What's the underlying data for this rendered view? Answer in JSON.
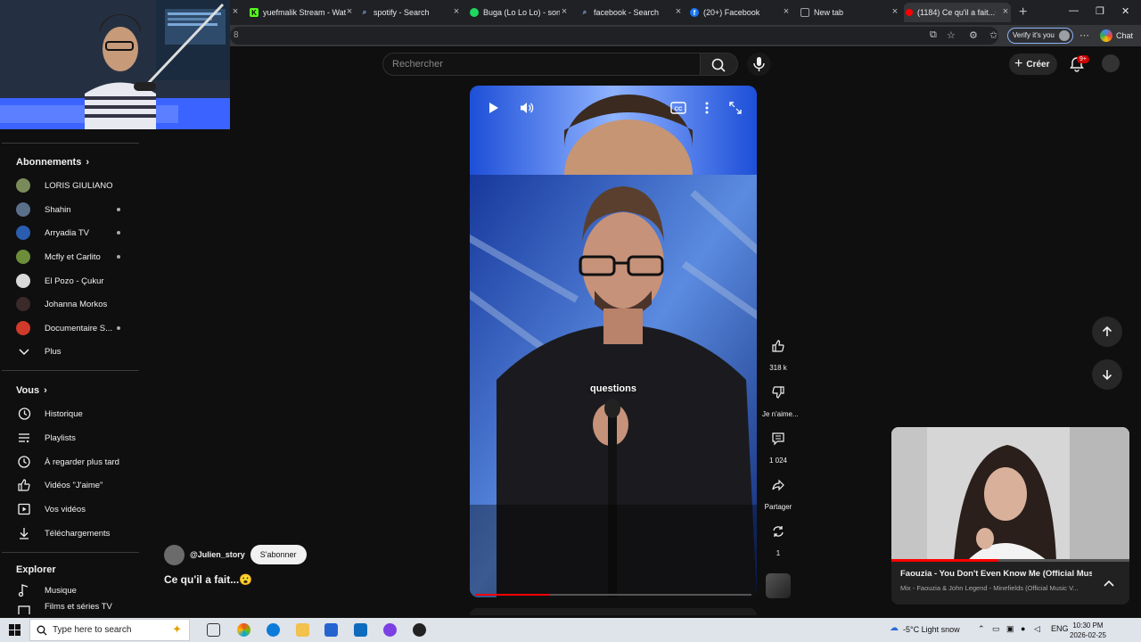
{
  "browser": {
    "tabs": [
      {
        "title": "yuefmalik Stream - Wat",
        "favicon": "kick-icon",
        "color": "#53fc18",
        "active": false
      },
      {
        "title": "spotify - Search",
        "favicon": "search-icon",
        "color": "#8ab4f8",
        "active": false
      },
      {
        "title": "Buga (Lo Lo Lo) - song a",
        "favicon": "spotify-icon",
        "color": "#1ed760",
        "active": false
      },
      {
        "title": "facebook - Search",
        "favicon": "search-icon",
        "color": "#8ab4f8",
        "active": false
      },
      {
        "title": "(20+) Facebook",
        "favicon": "facebook-icon",
        "color": "#1877f2",
        "active": false
      },
      {
        "title": "New tab",
        "favicon": "new-tab-icon",
        "color": "#9aa0a6",
        "active": false
      },
      {
        "title": "(1184) Ce qu'il a fait...😮",
        "favicon": "youtube-icon",
        "color": "#ff0000",
        "active": true
      }
    ],
    "address_fragment": "8",
    "verify_label": "Verify it's you",
    "chat_label": "Chat"
  },
  "header": {
    "search_placeholder": "Rechercher",
    "create_label": "Créer",
    "notifications_badge": "9+"
  },
  "sidebar": {
    "subscriptions_title": "Abonnements",
    "channels": [
      {
        "name": "LORIS GIULIANO",
        "color": "#7a8a5a",
        "new": false
      },
      {
        "name": "Shahin",
        "color": "#5a6f8a",
        "new": true
      },
      {
        "name": "Arryadia TV",
        "color": "#2a5db0",
        "new": true
      },
      {
        "name": "Mcfly et Carlito",
        "color": "#6c8e3a",
        "new": true
      },
      {
        "name": "El Pozo - Çukur",
        "color": "#d9d9d9",
        "new": false
      },
      {
        "name": "Johanna Morkos",
        "color": "#3a2a2a",
        "new": false
      },
      {
        "name": "Documentaire S...",
        "color": "#d03a2a",
        "new": true
      }
    ],
    "more_label": "Plus",
    "you_title": "Vous",
    "you_items": [
      {
        "label": "Historique",
        "icon": "history-icon"
      },
      {
        "label": "Playlists",
        "icon": "playlists-icon"
      },
      {
        "label": "À regarder plus tard",
        "icon": "watch-later-icon"
      },
      {
        "label": "Vidéos \"J'aime\"",
        "icon": "liked-videos-icon"
      },
      {
        "label": "Vos vidéos",
        "icon": "your-videos-icon"
      },
      {
        "label": "Téléchargements",
        "icon": "downloads-icon"
      }
    ],
    "explore_title": "Explorer",
    "explore_items": [
      {
        "label": "Musique",
        "icon": "music-icon"
      },
      {
        "label": "Films et séries TV",
        "icon": "movies-icon"
      }
    ]
  },
  "short": {
    "caption": "questions",
    "progress": 0.27,
    "channel": "@Julien_story",
    "subscribe_label": "S'abonner",
    "title": "Ce qu'il a fait...😮",
    "actions": {
      "likes": "318 k",
      "dislike_label": "Je n'aime...",
      "comments": "1 024",
      "share_label": "Partager",
      "remix_count": "1"
    }
  },
  "miniplayer": {
    "title": "Faouzia - You Don't Even Know Me (Official Musi...",
    "subtitle": "Mix - Faouzia & John Legend - Minefields (Official Music V...",
    "progress": 0.45
  },
  "taskbar": {
    "search_placeholder": "Type here to search",
    "weather": "-5°C  Light snow",
    "language": "ENG",
    "time": "10:30 PM",
    "date": "2026-02-25"
  },
  "colors": {
    "accent_red": "#ff0000",
    "background": "#0f0f0f"
  }
}
